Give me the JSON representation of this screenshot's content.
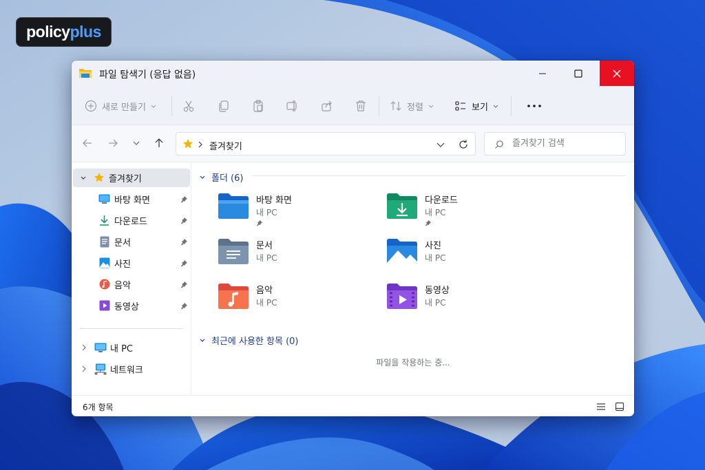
{
  "brand": {
    "word1": "policy",
    "word2": "plus"
  },
  "window": {
    "title": "파일 탐색기 (응답 없음)",
    "minimize_label": "",
    "maximize_label": "",
    "close_label": ""
  },
  "toolbar": {
    "new_label": "새로 만들기",
    "sort_label": "정렬",
    "view_label": "보기"
  },
  "address": {
    "crumb": "즐겨찾기",
    "search_placeholder": "즐겨찾기 검색"
  },
  "sidebar": {
    "favorites": "즐겨찾기",
    "items": [
      {
        "label": "바탕 화면",
        "icon": "desktop-icon"
      },
      {
        "label": "다운로드",
        "icon": "download-icon"
      },
      {
        "label": "문서",
        "icon": "document-icon"
      },
      {
        "label": "사진",
        "icon": "pictures-icon"
      },
      {
        "label": "음악",
        "icon": "music-icon"
      },
      {
        "label": "동영상",
        "icon": "video-icon"
      }
    ],
    "this_pc": "내 PC",
    "network": "네트워크"
  },
  "content": {
    "folders_header": "폴더 (6)",
    "folders": [
      {
        "name": "바탕 화면",
        "location": "내 PC",
        "pinned": true
      },
      {
        "name": "다운로드",
        "location": "내 PC",
        "pinned": true
      },
      {
        "name": "문서",
        "location": "내 PC",
        "pinned": false
      },
      {
        "name": "사진",
        "location": "내 PC",
        "pinned": false
      },
      {
        "name": "음악",
        "location": "내 PC",
        "pinned": false
      },
      {
        "name": "동영상",
        "location": "내 PC",
        "pinned": false
      }
    ],
    "recent_header": "최근에 사용한 항목 (0)",
    "loading_text": "파일을 작용하는 중..."
  },
  "status": {
    "count": "6개 항목"
  },
  "colors": {
    "accent": "#1f3c88",
    "close": "#e81123",
    "folder_blue": "#2a8ae0"
  }
}
